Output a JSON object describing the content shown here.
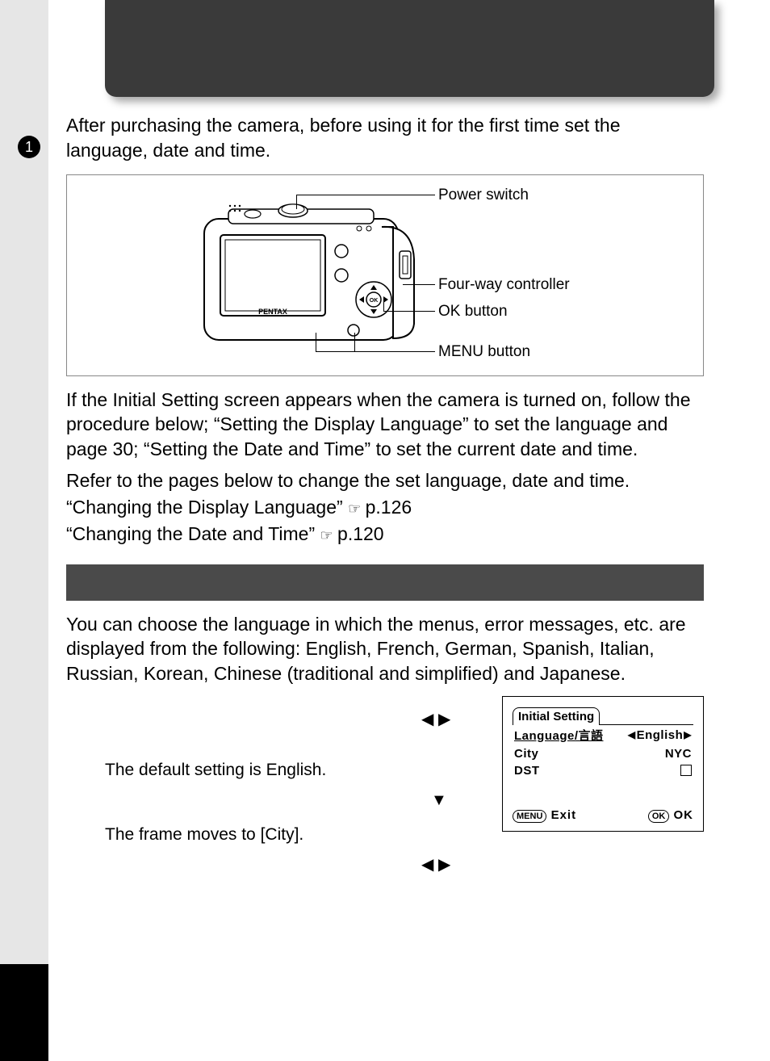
{
  "page": {
    "step_badge": "1",
    "intro": "After purchasing the camera, before using it for the first time set the language, date and time."
  },
  "figure": {
    "labels": {
      "power": "Power switch",
      "fourway": "Four-way controller",
      "ok": "OK button",
      "menu": "MENU button"
    },
    "brand": "PENTAX"
  },
  "body": {
    "p1": "If the Initial Setting screen appears when the camera is turned on, follow the procedure below; “Setting the Display Language” to set the language and page 30; “Setting the Date and Time” to set the current date and time.",
    "p2": "Refer to the pages below to change the set language, date and time.",
    "ref1_label": "“Changing the Display Language”",
    "ref1_icon": "☞",
    "ref1_page": "p.126",
    "ref2_label": "“Changing the Date and Time”",
    "ref2_icon": "☞",
    "ref2_page": "p.120"
  },
  "lang_section": {
    "p": "You can choose the language in which the menus, error messages, etc. are displayed from the following: English, French, German, Spanish, Italian, Russian, Korean, Chinese (traditional and simplified) and Japanese."
  },
  "lcd": {
    "title": "Initial Setting",
    "rows": {
      "language_key": "Language/言語",
      "language_val": "English",
      "city_key": "City",
      "city_val": "NYC",
      "dst_key": "DST"
    },
    "footer": {
      "menu_pill": "MENU",
      "exit": "Exit",
      "ok_pill": "OK",
      "ok": "OK"
    }
  },
  "steps": {
    "arrows_lr": "◀ ▶",
    "arrows_down": "▼",
    "s1_note": "The default setting is English.",
    "s2_note": "The frame moves to [City]."
  }
}
